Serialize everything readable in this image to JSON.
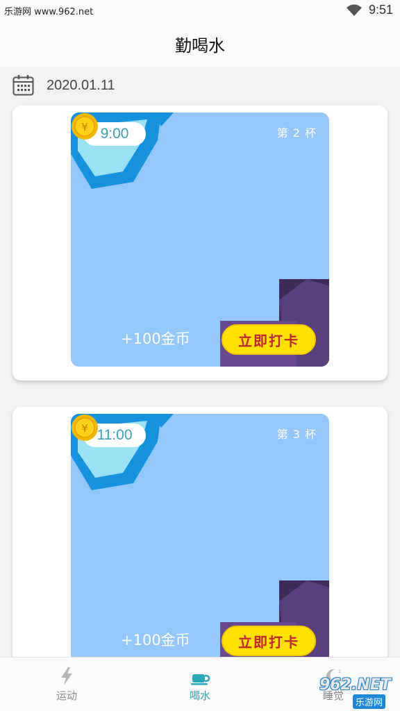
{
  "status_bar": {
    "carrier_text": "乐游网 www.962.net",
    "time": "9:51",
    "icons": [
      "wifi-icon",
      "battery-icon"
    ]
  },
  "app_bar": {
    "title": "勤喝水"
  },
  "date_row": {
    "date": "2020.01.11",
    "icon": "calendar-icon"
  },
  "cards": [
    {
      "time": "9:00",
      "cup_label": "第 2 杯",
      "reward": "+100金币",
      "button": "立即打卡"
    },
    {
      "time": "11:00",
      "cup_label": "第 3 杯",
      "reward": "+100金币",
      "button": "立即打卡"
    }
  ],
  "bottom_nav": {
    "items": [
      {
        "label": "运动",
        "icon": "lightning-icon",
        "active": false
      },
      {
        "label": "喝水",
        "icon": "cup-icon",
        "active": true
      },
      {
        "label": "睡觉",
        "icon": "moon-icon",
        "active": false
      }
    ]
  },
  "watermark": {
    "number": "962.NET",
    "site": "乐游网"
  },
  "colors": {
    "accent": "#2aa7b8",
    "card_art_bg": "#94c8fb",
    "button_yellow": "#ffe100",
    "button_text": "#c0262c"
  }
}
